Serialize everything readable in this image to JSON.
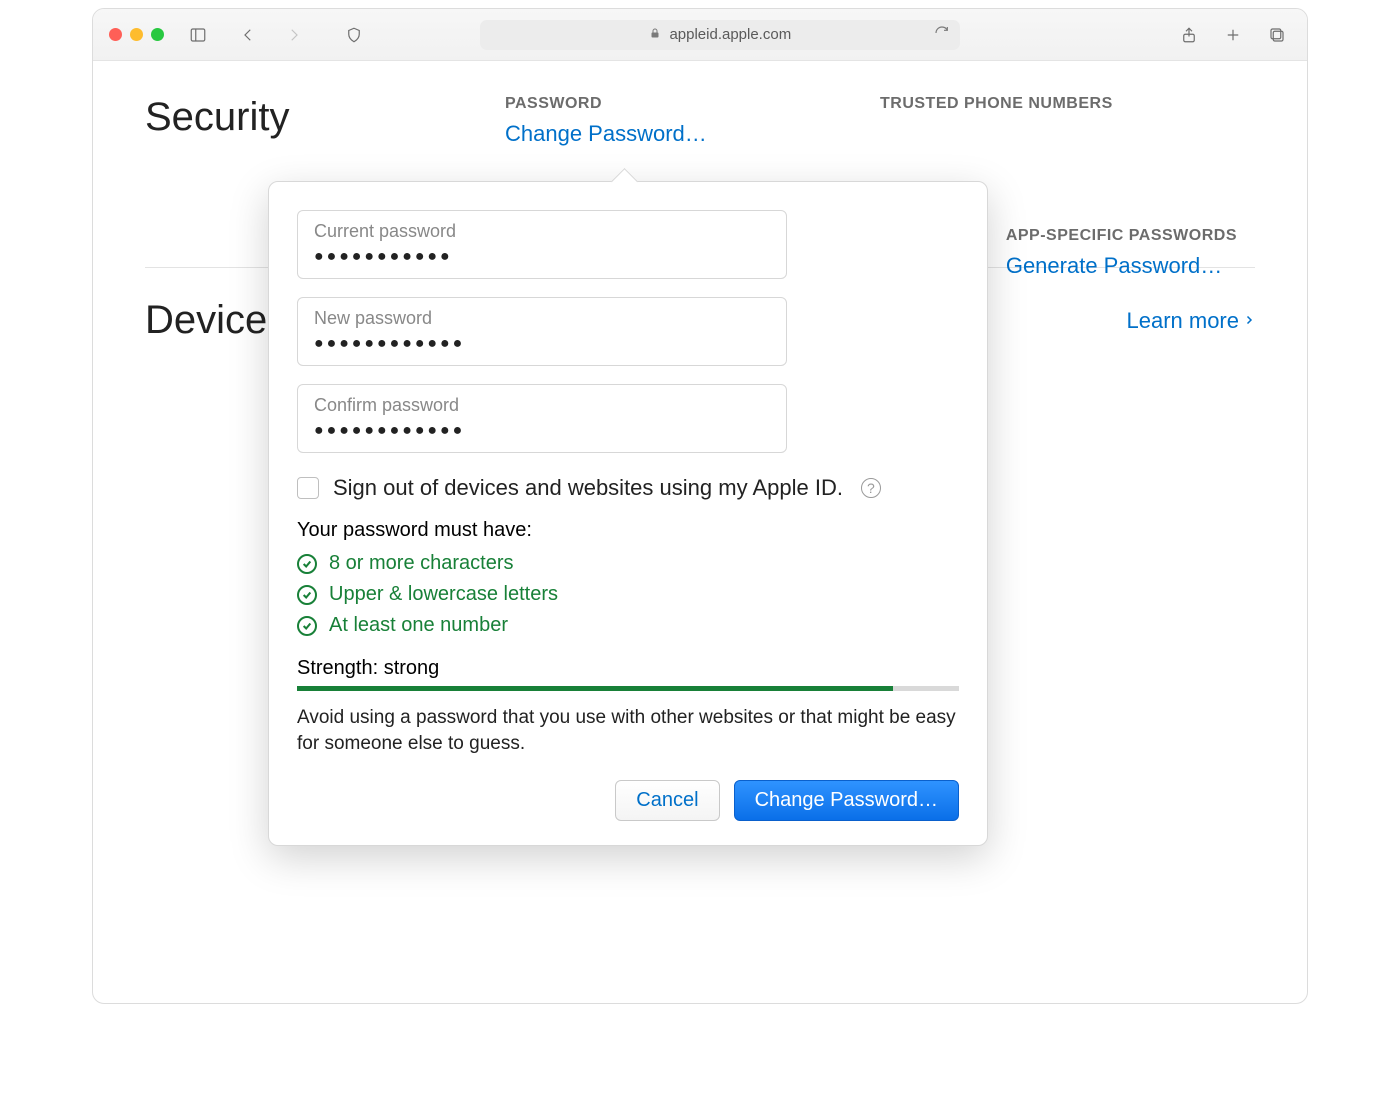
{
  "browser": {
    "url": "appleid.apple.com"
  },
  "page": {
    "security_title": "Security",
    "password_heading": "PASSWORD",
    "change_password_link": "Change Password…",
    "trusted_heading": "TRUSTED PHONE NUMBERS",
    "app_specific_heading": "APP-SPECIFIC PASSWORDS",
    "generate_password_link": "Generate Password…",
    "devices_title": "Devices",
    "learn_more": "Learn more"
  },
  "popover": {
    "current_label": "Current password",
    "current_value": "●●●●●●●●●●●",
    "new_label": "New password",
    "new_value": "●●●●●●●●●●●●",
    "confirm_label": "Confirm password",
    "confirm_value": "●●●●●●●●●●●●",
    "signout_label": "Sign out of devices and websites using my Apple ID.",
    "requirements_heading": "Your password must have:",
    "req1": "8 or more characters",
    "req2": "Upper & lowercase letters",
    "req3": "At least one number",
    "strength_label": "Strength: strong",
    "strength_percent": 90,
    "advice": "Avoid using a password that you use with other websites or that might be easy for someone else to guess.",
    "cancel": "Cancel",
    "submit": "Change Password…"
  }
}
